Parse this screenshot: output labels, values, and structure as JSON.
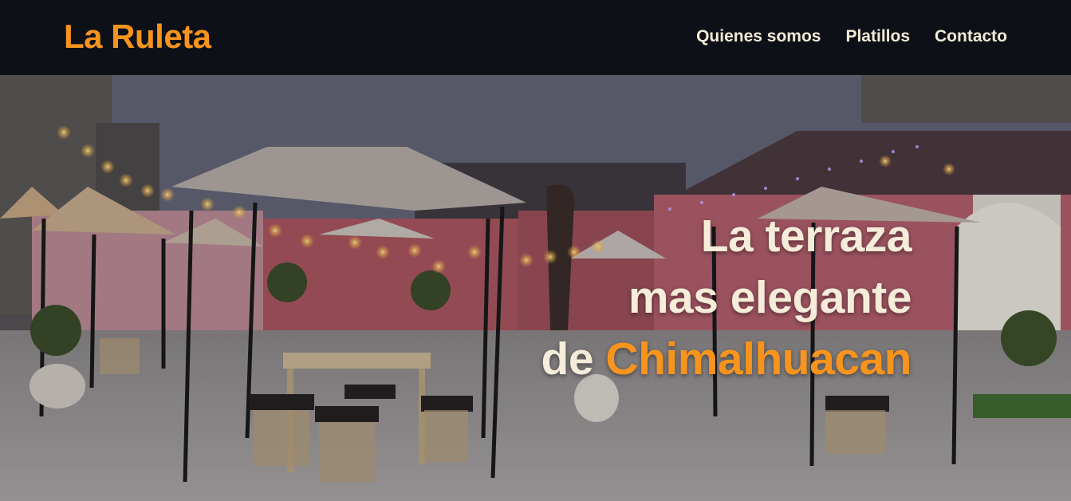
{
  "brand": {
    "name": "La Ruleta"
  },
  "nav": {
    "items": [
      {
        "label": "Quienes somos"
      },
      {
        "label": "Platillos"
      },
      {
        "label": "Contacto"
      }
    ]
  },
  "hero": {
    "line1": "La terraza",
    "line2": "mas elegante",
    "line3_prefix": "de ",
    "line3_accent": "Chimalhuacan"
  },
  "colors": {
    "accent": "#f7941d",
    "navbar_bg": "#0d1117",
    "hero_text": "#f5ecd9"
  }
}
